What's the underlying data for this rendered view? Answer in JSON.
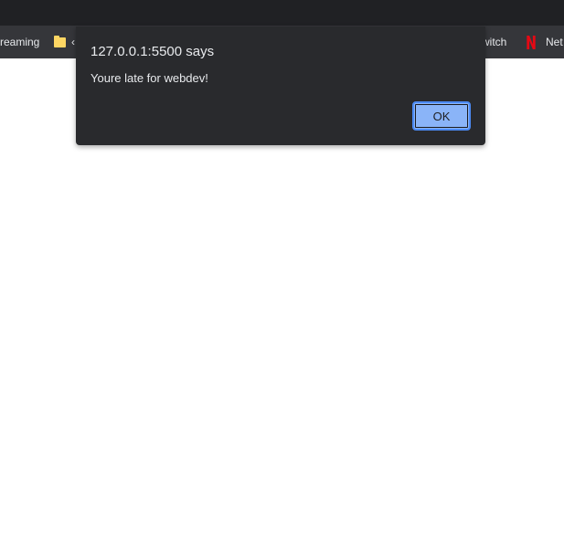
{
  "bookmarks": {
    "items": [
      {
        "label": "reaming",
        "icon": "none"
      },
      {
        "label": "‹",
        "icon": "folder-icon"
      },
      {
        "label": "witch",
        "icon": "none"
      },
      {
        "label": "Net",
        "icon": "netflix-icon"
      }
    ]
  },
  "colors": {
    "browser_top": "#202124",
    "bookmarks_bar": "#35363a",
    "dialog_bg": "#292a2d",
    "dialog_text": "#e8eaed",
    "button_bg": "#8ab4f8",
    "button_border": "#4c8bf5",
    "netflix_red": "#e50914",
    "folder_yellow": "#fdd663"
  },
  "dialog": {
    "title": "127.0.0.1:5500 says",
    "message": "Youre late for webdev!",
    "ok_label": "OK"
  }
}
